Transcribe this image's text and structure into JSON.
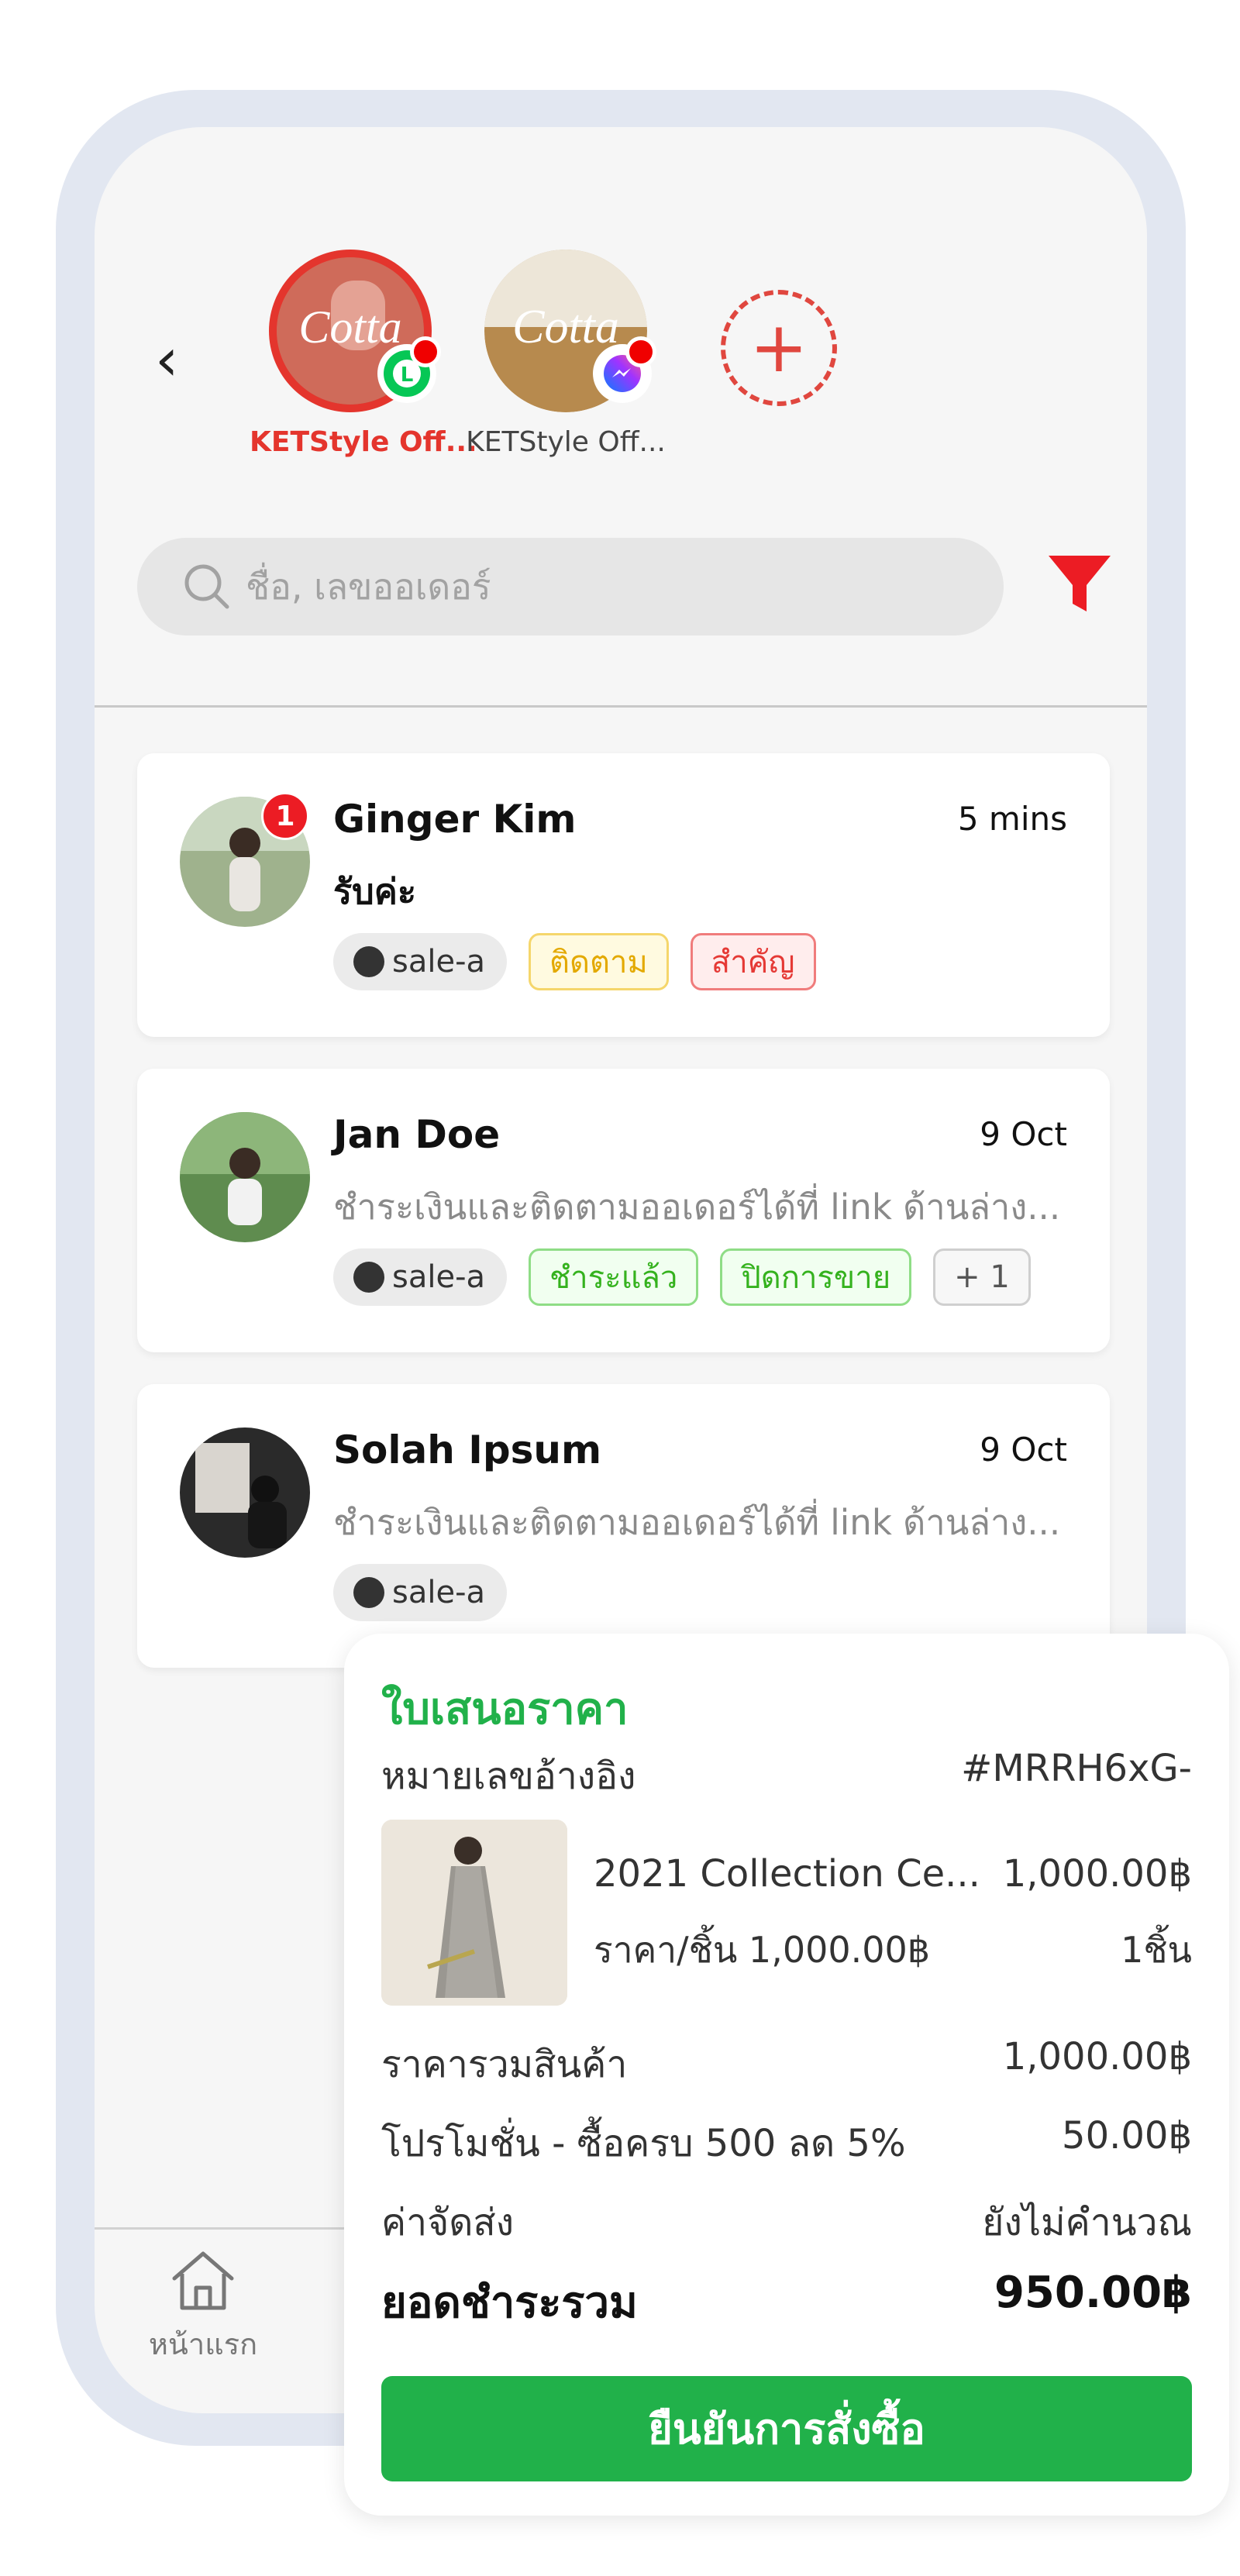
{
  "header": {
    "back_label": "‹",
    "stores": [
      {
        "name": "KETStyle Off...",
        "avatar_text": "Cotta",
        "channel": "line-icon",
        "active": true
      },
      {
        "name": "KETStyle Off...",
        "avatar_text": "Cotta",
        "channel": "messenger-icon",
        "active": false
      }
    ],
    "add_store_label": "+"
  },
  "search": {
    "placeholder": "ชื่อ, เลขออเดอร์"
  },
  "chats": [
    {
      "name": "Ginger Kim",
      "time": "5 mins",
      "message": "รับค่ะ",
      "unread": "1",
      "tags": [
        {
          "label": "sale-a",
          "kind": "sale"
        },
        {
          "label": "ติดตาม",
          "kind": "yellow"
        },
        {
          "label": "สำคัญ",
          "kind": "red"
        }
      ]
    },
    {
      "name": "Jan Doe",
      "time": "9 Oct",
      "message": "ชำระเงินและติดตามออเดอร์ได้ที่ link ด้านล่าง...",
      "tags": [
        {
          "label": "sale-a",
          "kind": "sale"
        },
        {
          "label": "ชำระแล้ว",
          "kind": "green"
        },
        {
          "label": "ปิดการขาย",
          "kind": "green"
        },
        {
          "label": "+ 1",
          "kind": "grey"
        }
      ]
    },
    {
      "name": "Solah Ipsum",
      "time": "9 Oct",
      "message": "ชำระเงินและติดตามออเดอร์ได้ที่ link ด้านล่าง...",
      "tags": [
        {
          "label": "sale-a",
          "kind": "sale"
        }
      ]
    }
  ],
  "bottom_nav": {
    "home_label": "หน้าแรก"
  },
  "quote": {
    "title": "ใบเสนอราคา",
    "ref_label": "หมายเลขอ้างอิง",
    "ref_value": "#MRRH6xG-",
    "product_name": "2021 Collection Ce...",
    "product_price": "1,000.00฿",
    "unit_price": "ราคา/ชิ้น 1,000.00฿",
    "quantity": "1ชิ้น",
    "subtotal_label": "ราคารวมสินค้า",
    "subtotal_value": "1,000.00฿",
    "promo_label": "โปรโมชั่น - ซื้อครบ 500 ลด 5%",
    "promo_value": "50.00฿",
    "shipping_label": "ค่าจัดส่ง",
    "shipping_value": "ยังไม่คำนวณ",
    "total_label": "ยอดชำระรวม",
    "total_value": "950.00฿",
    "confirm_label": "ยืนยันการสั่งซื้อ"
  },
  "colors": {
    "accent_red": "#e0473f",
    "line_green": "#06c755",
    "confirm_green": "#21b14a"
  }
}
